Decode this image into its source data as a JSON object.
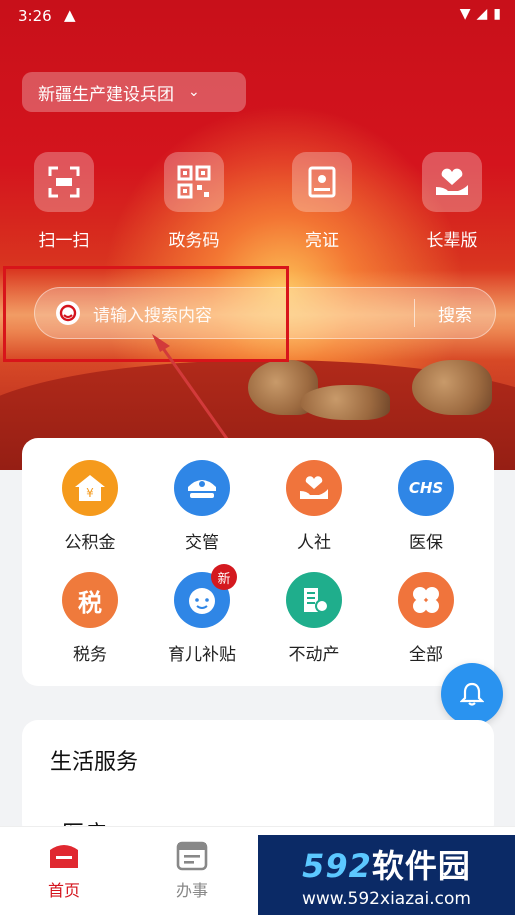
{
  "status_bar": {
    "time": "3:26",
    "warning": "▲"
  },
  "region": {
    "label": "新疆生产建设兵团"
  },
  "quick_actions": [
    {
      "label": "扫一扫",
      "icon": "scan-icon"
    },
    {
      "label": "政务码",
      "icon": "qr-code-icon"
    },
    {
      "label": "亮证",
      "icon": "certificate-icon"
    },
    {
      "label": "长辈版",
      "icon": "heart-hand-icon"
    }
  ],
  "search": {
    "placeholder": "请输入搜索内容",
    "button": "搜索"
  },
  "services": [
    {
      "label": "公积金",
      "color": "#f59a1c",
      "glyph": "¥"
    },
    {
      "label": "交管",
      "color": "#2f86e6",
      "glyph": "●"
    },
    {
      "label": "人社",
      "color": "#f0743c",
      "glyph": "♥"
    },
    {
      "label": "医保",
      "color": "#2f86e6",
      "glyph": "CHS"
    },
    {
      "label": "税务",
      "color": "#ef7a3c",
      "glyph": "税"
    },
    {
      "label": "育儿补贴",
      "color": "#2f86e6",
      "glyph": "☺",
      "badge": "新"
    },
    {
      "label": "不动产",
      "color": "#1fae8c",
      "glyph": "▤"
    },
    {
      "label": "全部",
      "color": "#f0743c",
      "glyph": "✤"
    }
  ],
  "life": {
    "title": "生活服务",
    "sub": "医疗"
  },
  "tabs": [
    {
      "label": "首页",
      "active": true
    },
    {
      "label": "办事",
      "active": false
    }
  ],
  "watermark": {
    "logo_num": "592",
    "logo_text": "软件园",
    "url": "www.592xiazai.com"
  },
  "colors": {
    "primary_red": "#d4141d",
    "accent_blue": "#2a93f0"
  }
}
